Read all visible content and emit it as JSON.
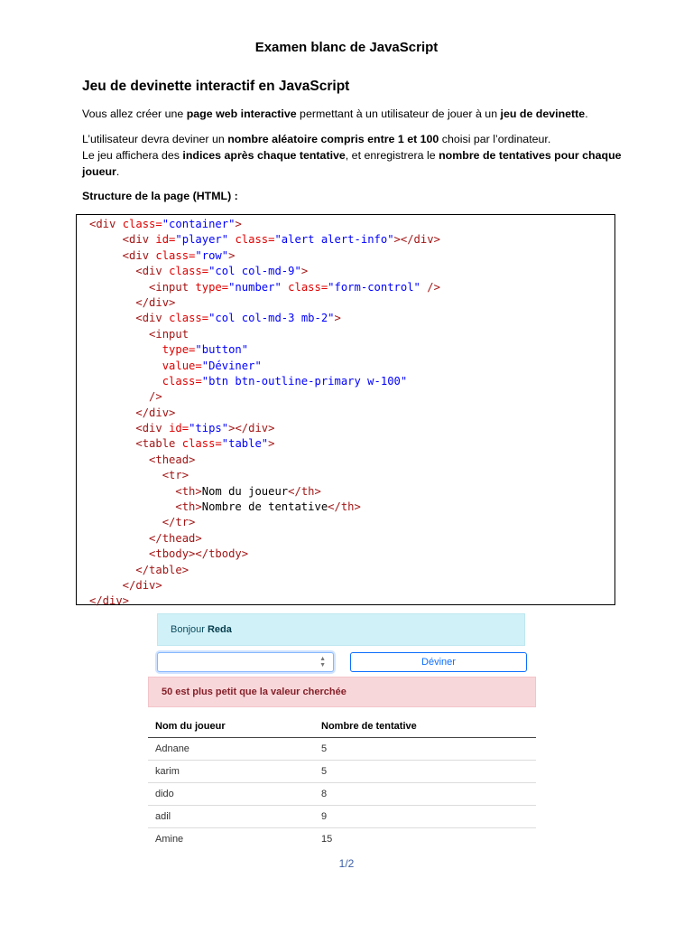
{
  "doc": {
    "title": "Examen blanc de JavaScript",
    "section_title": "Jeu de devinette interactif en JavaScript",
    "p1": {
      "a": "Vous allez créer une ",
      "b1": "page web interactive",
      "c": " permettant à un utilisateur de jouer à un ",
      "b2": "jeu de devinette",
      "d": "."
    },
    "p2": {
      "a": "L’utilisateur devra deviner un ",
      "b1": "nombre aléatoire compris entre 1 et 100",
      "c": " choisi par l’ordinateur.",
      "d": "Le jeu affichera des ",
      "b2": "indices après chaque tentative",
      "e": ", et enregistrera le ",
      "b3": "nombre de tentatives pour chaque joueur",
      "f": "."
    },
    "p3": "Structure de la page (HTML) :",
    "page_number": "1/2"
  },
  "code_lines": [
    [
      [
        "",
        "<div "
      ],
      [
        "attr",
        "class="
      ],
      [
        "val",
        "\"container\""
      ],
      [
        "tag",
        ">"
      ]
    ],
    [
      [
        "",
        "     <div "
      ],
      [
        "attr",
        "id="
      ],
      [
        "val",
        "\"player\" "
      ],
      [
        "attr",
        "class="
      ],
      [
        "val",
        "\"alert alert-info\""
      ],
      [
        "tag",
        "></div>"
      ]
    ],
    [
      [
        "",
        "     <div "
      ],
      [
        "attr",
        "class="
      ],
      [
        "val",
        "\"row\""
      ],
      [
        "tag",
        ">"
      ]
    ],
    [
      [
        "",
        "       <div "
      ],
      [
        "attr",
        "class="
      ],
      [
        "val",
        "\"col col-md-9\""
      ],
      [
        "tag",
        ">"
      ]
    ],
    [
      [
        "",
        "         <input "
      ],
      [
        "attr",
        "type="
      ],
      [
        "val",
        "\"number\" "
      ],
      [
        "attr",
        "class="
      ],
      [
        "val",
        "\"form-control\" "
      ],
      [
        "tag",
        "/>"
      ]
    ],
    [
      [
        "",
        "       </div>"
      ]
    ],
    [
      [
        "",
        "       <div "
      ],
      [
        "attr",
        "class="
      ],
      [
        "val",
        "\"col col-md-3 mb-2\""
      ],
      [
        "tag",
        ">"
      ]
    ],
    [
      [
        "",
        "         <input"
      ]
    ],
    [
      [
        "attr",
        "           type="
      ],
      [
        "val",
        "\"button\""
      ]
    ],
    [
      [
        "attr",
        "           value="
      ],
      [
        "val",
        "\"Déviner\""
      ]
    ],
    [
      [
        "attr",
        "           class="
      ],
      [
        "val",
        "\"btn btn-outline-primary w-100\""
      ]
    ],
    [
      [
        "",
        "         />"
      ]
    ],
    [
      [
        "",
        "       </div>"
      ]
    ],
    [
      [
        "",
        "       <div "
      ],
      [
        "attr",
        "id="
      ],
      [
        "val",
        "\"tips\""
      ],
      [
        "tag",
        "></div>"
      ]
    ],
    [
      [
        "",
        "       <table "
      ],
      [
        "attr",
        "class="
      ],
      [
        "val",
        "\"table\""
      ],
      [
        "tag",
        ">"
      ]
    ],
    [
      [
        "",
        "         <thead>"
      ]
    ],
    [
      [
        "",
        "           <tr>"
      ]
    ],
    [
      [
        "",
        "             <th>"
      ],
      [
        "txt",
        "Nom du joueur"
      ],
      [
        "tag",
        "</th>"
      ]
    ],
    [
      [
        "",
        "             <th>"
      ],
      [
        "txt",
        "Nombre de tentative"
      ],
      [
        "tag",
        "</th>"
      ]
    ],
    [
      [
        "",
        "           </tr>"
      ]
    ],
    [
      [
        "",
        "         </thead>"
      ]
    ],
    [
      [
        "",
        "         <tbody></tbody>"
      ]
    ],
    [
      [
        "",
        "       </table>"
      ]
    ],
    [
      [
        "",
        "     </div>"
      ]
    ],
    [
      [
        "",
        "</div>"
      ]
    ]
  ],
  "demo": {
    "greeting": "Bonjour ",
    "player_name": "Reda",
    "guess_button": "Déviner",
    "hint": "50 est plus petit que la valeur cherchée",
    "table": {
      "headers": [
        "Nom du joueur",
        "Nombre de tentative"
      ],
      "rows": [
        [
          "Adnane",
          "5"
        ],
        [
          "karim",
          "5"
        ],
        [
          "dido",
          "8"
        ],
        [
          "adil",
          "9"
        ],
        [
          "Amine",
          "15"
        ]
      ]
    }
  }
}
